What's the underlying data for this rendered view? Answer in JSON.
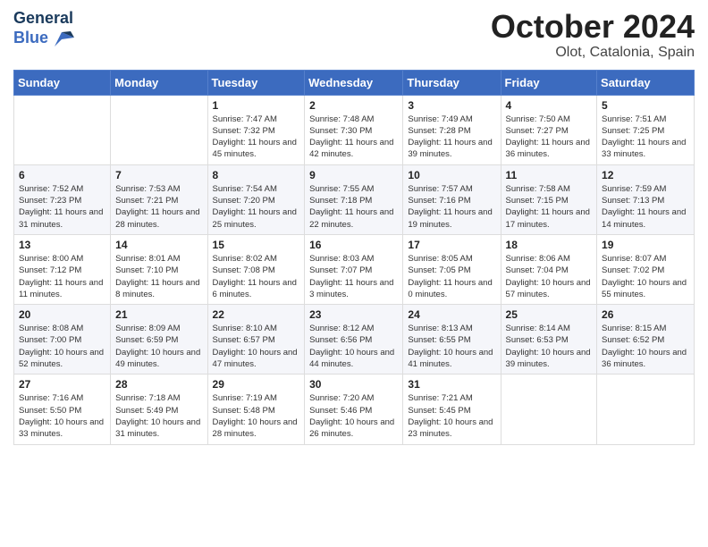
{
  "header": {
    "logo_line1": "General",
    "logo_line2": "Blue",
    "month": "October 2024",
    "location": "Olot, Catalonia, Spain"
  },
  "days_of_week": [
    "Sunday",
    "Monday",
    "Tuesday",
    "Wednesday",
    "Thursday",
    "Friday",
    "Saturday"
  ],
  "weeks": [
    [
      {
        "day": "",
        "info": ""
      },
      {
        "day": "",
        "info": ""
      },
      {
        "day": "1",
        "info": "Sunrise: 7:47 AM\nSunset: 7:32 PM\nDaylight: 11 hours and 45 minutes."
      },
      {
        "day": "2",
        "info": "Sunrise: 7:48 AM\nSunset: 7:30 PM\nDaylight: 11 hours and 42 minutes."
      },
      {
        "day": "3",
        "info": "Sunrise: 7:49 AM\nSunset: 7:28 PM\nDaylight: 11 hours and 39 minutes."
      },
      {
        "day": "4",
        "info": "Sunrise: 7:50 AM\nSunset: 7:27 PM\nDaylight: 11 hours and 36 minutes."
      },
      {
        "day": "5",
        "info": "Sunrise: 7:51 AM\nSunset: 7:25 PM\nDaylight: 11 hours and 33 minutes."
      }
    ],
    [
      {
        "day": "6",
        "info": "Sunrise: 7:52 AM\nSunset: 7:23 PM\nDaylight: 11 hours and 31 minutes."
      },
      {
        "day": "7",
        "info": "Sunrise: 7:53 AM\nSunset: 7:21 PM\nDaylight: 11 hours and 28 minutes."
      },
      {
        "day": "8",
        "info": "Sunrise: 7:54 AM\nSunset: 7:20 PM\nDaylight: 11 hours and 25 minutes."
      },
      {
        "day": "9",
        "info": "Sunrise: 7:55 AM\nSunset: 7:18 PM\nDaylight: 11 hours and 22 minutes."
      },
      {
        "day": "10",
        "info": "Sunrise: 7:57 AM\nSunset: 7:16 PM\nDaylight: 11 hours and 19 minutes."
      },
      {
        "day": "11",
        "info": "Sunrise: 7:58 AM\nSunset: 7:15 PM\nDaylight: 11 hours and 17 minutes."
      },
      {
        "day": "12",
        "info": "Sunrise: 7:59 AM\nSunset: 7:13 PM\nDaylight: 11 hours and 14 minutes."
      }
    ],
    [
      {
        "day": "13",
        "info": "Sunrise: 8:00 AM\nSunset: 7:12 PM\nDaylight: 11 hours and 11 minutes."
      },
      {
        "day": "14",
        "info": "Sunrise: 8:01 AM\nSunset: 7:10 PM\nDaylight: 11 hours and 8 minutes."
      },
      {
        "day": "15",
        "info": "Sunrise: 8:02 AM\nSunset: 7:08 PM\nDaylight: 11 hours and 6 minutes."
      },
      {
        "day": "16",
        "info": "Sunrise: 8:03 AM\nSunset: 7:07 PM\nDaylight: 11 hours and 3 minutes."
      },
      {
        "day": "17",
        "info": "Sunrise: 8:05 AM\nSunset: 7:05 PM\nDaylight: 11 hours and 0 minutes."
      },
      {
        "day": "18",
        "info": "Sunrise: 8:06 AM\nSunset: 7:04 PM\nDaylight: 10 hours and 57 minutes."
      },
      {
        "day": "19",
        "info": "Sunrise: 8:07 AM\nSunset: 7:02 PM\nDaylight: 10 hours and 55 minutes."
      }
    ],
    [
      {
        "day": "20",
        "info": "Sunrise: 8:08 AM\nSunset: 7:00 PM\nDaylight: 10 hours and 52 minutes."
      },
      {
        "day": "21",
        "info": "Sunrise: 8:09 AM\nSunset: 6:59 PM\nDaylight: 10 hours and 49 minutes."
      },
      {
        "day": "22",
        "info": "Sunrise: 8:10 AM\nSunset: 6:57 PM\nDaylight: 10 hours and 47 minutes."
      },
      {
        "day": "23",
        "info": "Sunrise: 8:12 AM\nSunset: 6:56 PM\nDaylight: 10 hours and 44 minutes."
      },
      {
        "day": "24",
        "info": "Sunrise: 8:13 AM\nSunset: 6:55 PM\nDaylight: 10 hours and 41 minutes."
      },
      {
        "day": "25",
        "info": "Sunrise: 8:14 AM\nSunset: 6:53 PM\nDaylight: 10 hours and 39 minutes."
      },
      {
        "day": "26",
        "info": "Sunrise: 8:15 AM\nSunset: 6:52 PM\nDaylight: 10 hours and 36 minutes."
      }
    ],
    [
      {
        "day": "27",
        "info": "Sunrise: 7:16 AM\nSunset: 5:50 PM\nDaylight: 10 hours and 33 minutes."
      },
      {
        "day": "28",
        "info": "Sunrise: 7:18 AM\nSunset: 5:49 PM\nDaylight: 10 hours and 31 minutes."
      },
      {
        "day": "29",
        "info": "Sunrise: 7:19 AM\nSunset: 5:48 PM\nDaylight: 10 hours and 28 minutes."
      },
      {
        "day": "30",
        "info": "Sunrise: 7:20 AM\nSunset: 5:46 PM\nDaylight: 10 hours and 26 minutes."
      },
      {
        "day": "31",
        "info": "Sunrise: 7:21 AM\nSunset: 5:45 PM\nDaylight: 10 hours and 23 minutes."
      },
      {
        "day": "",
        "info": ""
      },
      {
        "day": "",
        "info": ""
      }
    ]
  ]
}
